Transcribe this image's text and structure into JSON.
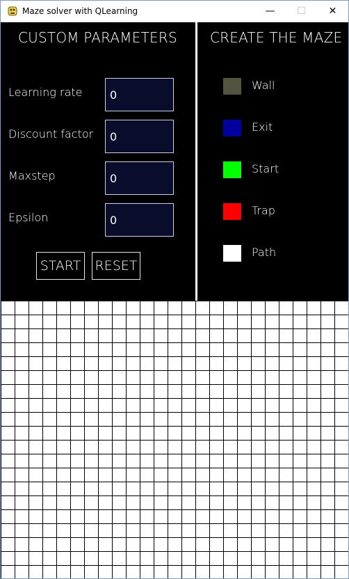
{
  "window": {
    "title": "Maze solver with QLearning",
    "minimize_glyph": "—",
    "maximize_glyph": "☐",
    "close_glyph": "✕"
  },
  "params_panel": {
    "title": "CUSTOM PARAMETERS",
    "fields": [
      {
        "label": "Learning rate",
        "value": "0"
      },
      {
        "label": "Discount factor",
        "value": "0"
      },
      {
        "label": "Maxstep",
        "value": "0"
      },
      {
        "label": "Epsilon",
        "value": "0"
      }
    ],
    "start_label": "START",
    "reset_label": "RESET"
  },
  "maze_panel": {
    "title": "CREATE THE MAZE",
    "legend": [
      {
        "label": "Wall",
        "color": "#55533f"
      },
      {
        "label": "Exit",
        "color": "#0000a0"
      },
      {
        "label": "Start",
        "color": "#00ff00"
      },
      {
        "label": "Trap",
        "color": "#ff0000"
      },
      {
        "label": "Path",
        "color": "#ffffff"
      }
    ]
  },
  "colors": {
    "panel_bg": "#000000",
    "input_bg": "#0a0c2c",
    "grid_line": "#000000",
    "grid_bg": "#ffffff"
  }
}
